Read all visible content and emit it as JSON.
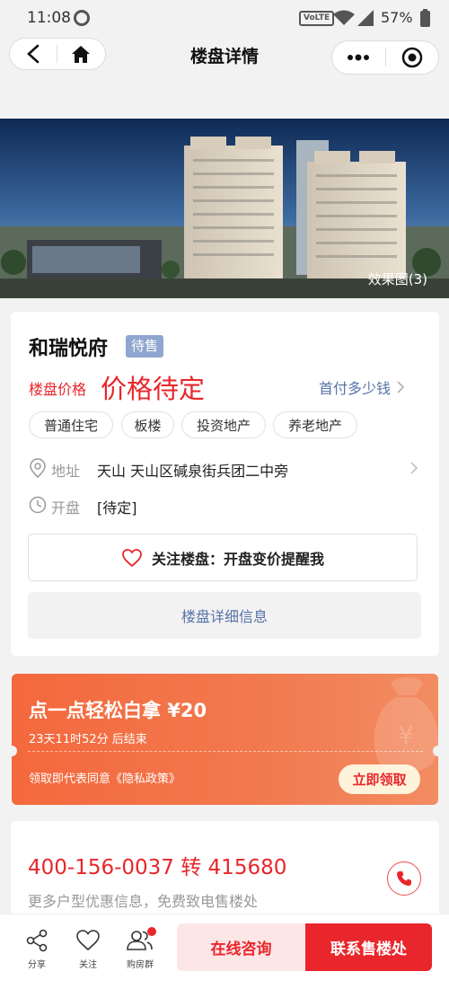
{
  "status_bar": {
    "time": "11:08",
    "network": "VoLTE",
    "battery": "57%"
  },
  "nav": {
    "title": "楼盘详情"
  },
  "hero": {
    "caption": "效果图(3)"
  },
  "project": {
    "name": "和瑞悦府",
    "status_badge": "待售",
    "price_label": "楼盘价格",
    "price_value": "价格待定",
    "down_payment_link": "首付多少钱",
    "tags": [
      "普通住宅",
      "板楼",
      "投资地产",
      "养老地产"
    ],
    "address_label": "地址",
    "address_value": "天山 天山区碱泉街兵团二中旁",
    "opening_label": "开盘",
    "opening_value": "[待定]",
    "follow_button": "关注楼盘：开盘变价提醒我",
    "detail_button": "楼盘详细信息"
  },
  "promo": {
    "title": "点一点轻松白拿 ¥20",
    "countdown": "23天11时52分 后结束",
    "policy": "领取即代表同意《隐私政策》",
    "claim_button": "立即领取"
  },
  "contact": {
    "phone": "400-156-0037 转 415680",
    "subtitle": "更多户型优惠信息，免费致电售楼处"
  },
  "bottom_bar": {
    "share": "分享",
    "follow": "关注",
    "group": "购房群",
    "consult_button": "在线咨询",
    "call_button": "联系售楼处"
  },
  "colors": {
    "accent_red": "#e8262b",
    "promo_orange": "#f4683d",
    "link_blue": "#5874a8"
  }
}
